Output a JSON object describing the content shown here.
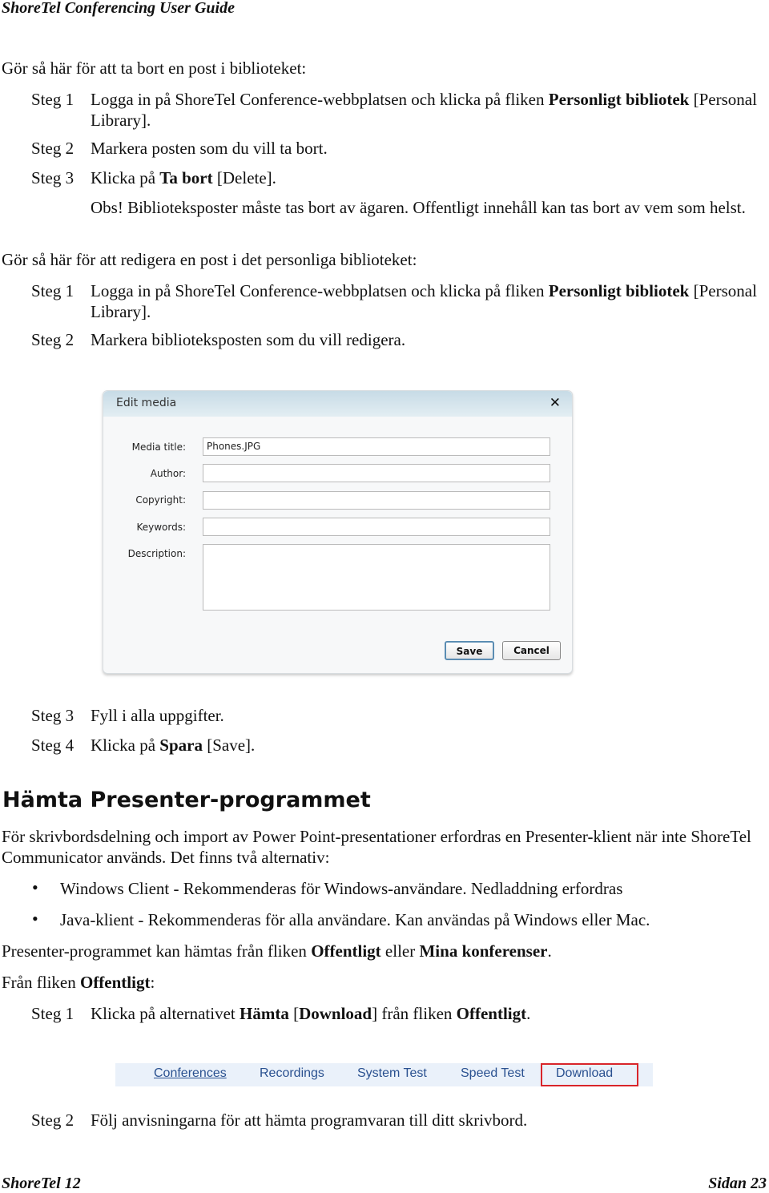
{
  "header": {
    "title": "ShoreTel Conferencing User Guide"
  },
  "section1": {
    "intro": "Gör så här för att ta bort en post i biblioteket:",
    "steps": [
      {
        "label": "Steg 1",
        "segments": [
          {
            "t": "Logga in på ShoreTel Conference-webbplatsen och klicka på fliken "
          },
          {
            "t": "Personligt bibliotek",
            "b": true
          },
          {
            "t": " [Personal Library]."
          }
        ]
      },
      {
        "label": "Steg 2",
        "segments": [
          {
            "t": "Markera posten som du vill ta bort."
          }
        ]
      },
      {
        "label": "Steg 3",
        "segments": [
          {
            "t": "Klicka på "
          },
          {
            "t": "Ta bort",
            "b": true
          },
          {
            "t": " [Delete]."
          }
        ]
      }
    ],
    "note": [
      {
        "t": "Obs!",
        "b": false
      },
      {
        "t": " Biblioteksposter måste tas bort av ägaren. Offentligt innehåll kan tas bort av vem som helst."
      }
    ]
  },
  "section2": {
    "intro": "Gör så här för att redigera en post i det personliga biblioteket:",
    "steps": [
      {
        "label": "Steg 1",
        "segments": [
          {
            "t": "Logga in på ShoreTel Conference-webbplatsen och klicka på fliken "
          },
          {
            "t": "Personligt bibliotek",
            "b": true
          },
          {
            "t": " [Personal Library]."
          }
        ]
      },
      {
        "label": "Steg 2",
        "segments": [
          {
            "t": "Markera biblioteksposten som du vill redigera."
          }
        ]
      },
      {
        "label": "Steg 3",
        "segments": [
          {
            "t": "Fyll i alla uppgifter."
          }
        ]
      },
      {
        "label": "Steg 4",
        "segments": [
          {
            "t": "Klicka på "
          },
          {
            "t": "Spara",
            "b": true
          },
          {
            "t": " [Save]."
          }
        ]
      }
    ]
  },
  "dialog": {
    "title": "Edit media",
    "close_icon": "close-x-icon",
    "fields": [
      {
        "label": "Media title:",
        "value": "Phones.JPG"
      },
      {
        "label": "Author:",
        "value": ""
      },
      {
        "label": "Copyright:",
        "value": ""
      },
      {
        "label": "Keywords:",
        "value": ""
      },
      {
        "label": "Description:",
        "value": ""
      }
    ],
    "save": "Save",
    "cancel": "Cancel"
  },
  "section3": {
    "heading": "Hämta Presenter-programmet",
    "para": "För skrivbordsdelning och import av Power Point-presentationer erfordras en Presenter-klient när inte ShoreTel Communicator används. Det finns två alternativ:",
    "bullets": [
      "Windows Client - Rekommenderas för Windows-användare. Nedladdning erfordras",
      "Java-klient - Rekommenderas för alla användare. Kan användas på Windows eller Mac."
    ],
    "para2": [
      {
        "t": "Presenter-programmet kan hämtas från fliken "
      },
      {
        "t": "Offentligt",
        "b": true
      },
      {
        "t": " eller "
      },
      {
        "t": "Mina konferenser",
        "b": true
      },
      {
        "t": "."
      }
    ],
    "para3": [
      {
        "t": "Från fliken "
      },
      {
        "t": "Offentligt",
        "b": true
      },
      {
        "t": ":"
      }
    ],
    "steps": [
      {
        "label": "Steg 1",
        "segments": [
          {
            "t": "Klicka på alternativet "
          },
          {
            "t": "Hämta",
            "b": true
          },
          {
            "t": " ["
          },
          {
            "t": "Download",
            "b": true
          },
          {
            "t": "] från fliken "
          },
          {
            "t": "Offentligt",
            "b": true
          },
          {
            "t": "."
          }
        ]
      },
      {
        "label": "Steg 2",
        "segments": [
          {
            "t": "Följ anvisningarna för att hämta programvaran till ditt skrivbord."
          }
        ]
      }
    ]
  },
  "nav": {
    "tabs": [
      "Conferences",
      "Recordings",
      "System Test",
      "Speed Test",
      "Download"
    ],
    "highlight_color": "#d9252a",
    "link_color": "#2a5190"
  },
  "footer": {
    "left": "ShoreTel 12",
    "right": "Sidan 23"
  }
}
